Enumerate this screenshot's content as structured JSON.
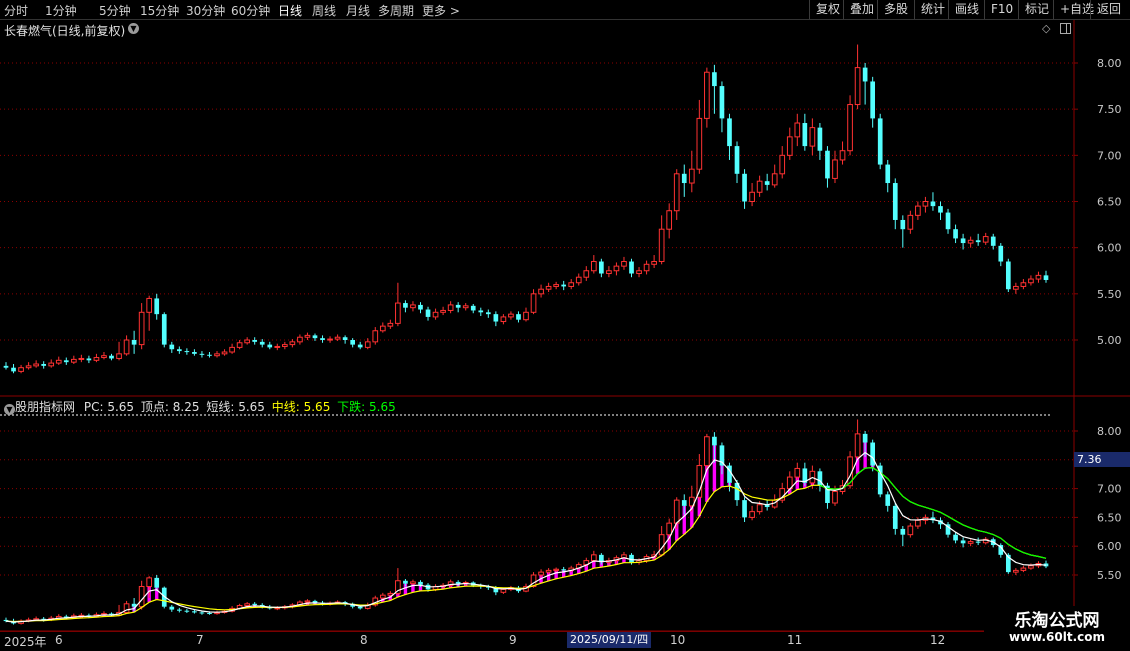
{
  "toolbar": {
    "periods": [
      "分时",
      "1分钟",
      "5分钟",
      "15分钟",
      "30分钟",
      "60分钟",
      "日线",
      "周线",
      "月线",
      "多周期",
      "更多 >"
    ],
    "active_period": "日线",
    "buttons": [
      "复权",
      "叠加",
      "多股",
      "统计",
      "画线",
      "F10",
      "标记",
      "+自选",
      "返回"
    ]
  },
  "stock_title": "长春燃气(日线,前复权)",
  "indicator": {
    "name": "股朋指标网",
    "pc_label": "PC:",
    "pc_value": "5.65",
    "top_label": "顶点:",
    "top_value": "8.25",
    "short_label": "短线:",
    "short_value": "5.65",
    "mid_label": "中线:",
    "mid_value": "5.65",
    "down_label": "下跌:",
    "down_value": "5.65"
  },
  "cursor_price": "7.36",
  "cursor_date": "2025/09/11/四",
  "date_labels": [
    "2025年",
    "6",
    "7",
    "8",
    "9",
    "10",
    "11",
    "12"
  ],
  "watermark": {
    "title": "乐淘公式网",
    "url": "www.60lt.com"
  },
  "colors": {
    "up": "#ff3232",
    "down": "#54ffff",
    "grid": "#8b0000",
    "white_line": "#ffffff",
    "yellow_line": "#ffff00",
    "green_line": "#00ff00",
    "magenta": "#ff00ff"
  },
  "chart_data": {
    "type": "candlestick",
    "y_ticks_main": [
      "8.00",
      "7.50",
      "7.00",
      "6.50",
      "6.00",
      "5.50",
      "5.00"
    ],
    "y_ticks_ind": [
      "8.00",
      "7.50",
      "7.00",
      "6.50",
      "6.00",
      "5.50"
    ],
    "ylim_main": [
      4.6,
      8.3
    ],
    "ylim_ind": [
      5.3,
      8.4
    ],
    "candles": [
      [
        4.72,
        4.7,
        4.76,
        4.68
      ],
      [
        4.7,
        4.66,
        4.74,
        4.64
      ],
      [
        4.66,
        4.7,
        4.73,
        4.64
      ],
      [
        4.7,
        4.72,
        4.76,
        4.68
      ],
      [
        4.72,
        4.74,
        4.78,
        4.7
      ],
      [
        4.74,
        4.72,
        4.77,
        4.69
      ],
      [
        4.72,
        4.75,
        4.79,
        4.7
      ],
      [
        4.75,
        4.78,
        4.82,
        4.73
      ],
      [
        4.78,
        4.76,
        4.81,
        4.73
      ],
      [
        4.76,
        4.79,
        4.83,
        4.74
      ],
      [
        4.79,
        4.8,
        4.84,
        4.76
      ],
      [
        4.8,
        4.78,
        4.83,
        4.75
      ],
      [
        4.78,
        4.81,
        4.85,
        4.76
      ],
      [
        4.81,
        4.83,
        4.87,
        4.79
      ],
      [
        4.83,
        4.8,
        4.85,
        4.78
      ],
      [
        4.8,
        4.85,
        4.98,
        4.78
      ],
      [
        4.85,
        5.0,
        5.05,
        4.83
      ],
      [
        5.0,
        4.95,
        5.1,
        4.85
      ],
      [
        4.95,
        5.3,
        5.4,
        4.9
      ],
      [
        5.3,
        5.45,
        5.48,
        5.1
      ],
      [
        5.45,
        5.28,
        5.5,
        5.22
      ],
      [
        5.28,
        4.95,
        5.3,
        4.92
      ],
      [
        4.95,
        4.9,
        4.98,
        4.86
      ],
      [
        4.9,
        4.88,
        4.93,
        4.85
      ],
      [
        4.88,
        4.87,
        4.91,
        4.84
      ],
      [
        4.87,
        4.85,
        4.9,
        4.83
      ],
      [
        4.85,
        4.84,
        4.88,
        4.81
      ],
      [
        4.84,
        4.83,
        4.87,
        4.81
      ],
      [
        4.83,
        4.85,
        4.88,
        4.81
      ],
      [
        4.85,
        4.87,
        4.9,
        4.83
      ],
      [
        4.87,
        4.92,
        4.96,
        4.85
      ],
      [
        4.92,
        4.97,
        5.0,
        4.9
      ],
      [
        4.97,
        5.0,
        5.03,
        4.95
      ],
      [
        5.0,
        4.98,
        5.03,
        4.95
      ],
      [
        4.98,
        4.95,
        5.01,
        4.92
      ],
      [
        4.95,
        4.92,
        4.98,
        4.9
      ],
      [
        4.92,
        4.93,
        4.96,
        4.89
      ],
      [
        4.93,
        4.95,
        4.98,
        4.9
      ],
      [
        4.95,
        4.98,
        5.01,
        4.92
      ],
      [
        4.98,
        5.03,
        5.06,
        4.95
      ],
      [
        5.03,
        5.05,
        5.08,
        5.0
      ],
      [
        5.05,
        5.02,
        5.07,
        4.99
      ],
      [
        5.02,
        5.0,
        5.05,
        4.97
      ],
      [
        5.0,
        5.01,
        5.04,
        4.97
      ],
      [
        5.01,
        5.03,
        5.06,
        4.99
      ],
      [
        5.03,
        5.0,
        5.05,
        4.96
      ],
      [
        5.0,
        4.95,
        5.02,
        4.92
      ],
      [
        4.95,
        4.92,
        4.98,
        4.9
      ],
      [
        4.92,
        4.98,
        5.02,
        4.9
      ],
      [
        4.98,
        5.1,
        5.14,
        4.95
      ],
      [
        5.1,
        5.15,
        5.19,
        5.08
      ],
      [
        5.15,
        5.18,
        5.22,
        5.12
      ],
      [
        5.18,
        5.4,
        5.62,
        5.15
      ],
      [
        5.4,
        5.35,
        5.43,
        5.3
      ],
      [
        5.35,
        5.38,
        5.42,
        5.31
      ],
      [
        5.38,
        5.33,
        5.41,
        5.29
      ],
      [
        5.33,
        5.25,
        5.36,
        5.21
      ],
      [
        5.25,
        5.3,
        5.34,
        5.22
      ],
      [
        5.3,
        5.32,
        5.36,
        5.27
      ],
      [
        5.32,
        5.38,
        5.42,
        5.29
      ],
      [
        5.38,
        5.35,
        5.41,
        5.3
      ],
      [
        5.35,
        5.37,
        5.4,
        5.32
      ],
      [
        5.37,
        5.32,
        5.39,
        5.29
      ],
      [
        5.32,
        5.3,
        5.35,
        5.26
      ],
      [
        5.3,
        5.28,
        5.33,
        5.24
      ],
      [
        5.28,
        5.2,
        5.31,
        5.15
      ],
      [
        5.2,
        5.25,
        5.28,
        5.17
      ],
      [
        5.25,
        5.28,
        5.31,
        5.22
      ],
      [
        5.28,
        5.22,
        5.31,
        5.19
      ],
      [
        5.22,
        5.3,
        5.35,
        5.2
      ],
      [
        5.3,
        5.5,
        5.55,
        5.28
      ],
      [
        5.5,
        5.55,
        5.6,
        5.46
      ],
      [
        5.55,
        5.58,
        5.62,
        5.52
      ],
      [
        5.58,
        5.6,
        5.63,
        5.55
      ],
      [
        5.6,
        5.58,
        5.64,
        5.54
      ],
      [
        5.58,
        5.62,
        5.66,
        5.55
      ],
      [
        5.62,
        5.68,
        5.72,
        5.59
      ],
      [
        5.68,
        5.75,
        5.8,
        5.64
      ],
      [
        5.75,
        5.85,
        5.92,
        5.72
      ],
      [
        5.85,
        5.72,
        5.88,
        5.68
      ],
      [
        5.72,
        5.75,
        5.8,
        5.68
      ],
      [
        5.75,
        5.8,
        5.84,
        5.7
      ],
      [
        5.8,
        5.85,
        5.9,
        5.76
      ],
      [
        5.85,
        5.72,
        5.88,
        5.68
      ],
      [
        5.72,
        5.75,
        5.79,
        5.68
      ],
      [
        5.75,
        5.82,
        5.86,
        5.71
      ],
      [
        5.82,
        5.85,
        5.92,
        5.78
      ],
      [
        5.85,
        6.2,
        6.35,
        5.82
      ],
      [
        6.2,
        6.4,
        6.48,
        6.1
      ],
      [
        6.4,
        6.8,
        6.85,
        6.3
      ],
      [
        6.8,
        6.7,
        6.9,
        6.55
      ],
      [
        6.7,
        6.85,
        7.05,
        6.6
      ],
      [
        6.85,
        7.4,
        7.6,
        6.8
      ],
      [
        7.4,
        7.9,
        7.95,
        7.3
      ],
      [
        7.9,
        7.75,
        7.98,
        7.45
      ],
      [
        7.75,
        7.4,
        7.8,
        7.25
      ],
      [
        7.4,
        7.1,
        7.45,
        6.95
      ],
      [
        7.1,
        6.8,
        7.15,
        6.7
      ],
      [
        6.8,
        6.5,
        6.85,
        6.42
      ],
      [
        6.5,
        6.6,
        6.7,
        6.45
      ],
      [
        6.6,
        6.72,
        6.78,
        6.55
      ],
      [
        6.72,
        6.68,
        6.8,
        6.62
      ],
      [
        6.68,
        6.8,
        6.9,
        6.65
      ],
      [
        6.8,
        7.0,
        7.1,
        6.75
      ],
      [
        7.0,
        7.2,
        7.3,
        6.95
      ],
      [
        7.2,
        7.35,
        7.45,
        7.1
      ],
      [
        7.35,
        7.1,
        7.45,
        7.05
      ],
      [
        7.1,
        7.3,
        7.4,
        7.0
      ],
      [
        7.3,
        7.05,
        7.35,
        6.95
      ],
      [
        7.05,
        6.75,
        7.1,
        6.65
      ],
      [
        6.75,
        6.95,
        7.05,
        6.7
      ],
      [
        6.95,
        7.05,
        7.15,
        6.9
      ],
      [
        7.05,
        7.55,
        7.65,
        7.0
      ],
      [
        7.55,
        7.95,
        8.2,
        7.5
      ],
      [
        7.95,
        7.8,
        8.0,
        7.55
      ],
      [
        7.8,
        7.4,
        7.85,
        7.3
      ],
      [
        7.4,
        6.9,
        7.45,
        6.85
      ],
      [
        6.9,
        6.7,
        6.95,
        6.6
      ],
      [
        6.7,
        6.3,
        6.75,
        6.2
      ],
      [
        6.3,
        6.2,
        6.35,
        6.0
      ],
      [
        6.2,
        6.35,
        6.4,
        6.15
      ],
      [
        6.35,
        6.45,
        6.5,
        6.3
      ],
      [
        6.45,
        6.5,
        6.55,
        6.38
      ],
      [
        6.5,
        6.45,
        6.6,
        6.4
      ],
      [
        6.45,
        6.38,
        6.5,
        6.3
      ],
      [
        6.38,
        6.2,
        6.42,
        6.15
      ],
      [
        6.2,
        6.1,
        6.25,
        6.05
      ],
      [
        6.1,
        6.05,
        6.15,
        5.98
      ],
      [
        6.05,
        6.08,
        6.12,
        6.0
      ],
      [
        6.08,
        6.06,
        6.15,
        6.02
      ],
      [
        6.06,
        6.12,
        6.16,
        6.03
      ],
      [
        6.12,
        6.02,
        6.15,
        5.98
      ],
      [
        6.02,
        5.85,
        6.05,
        5.8
      ],
      [
        5.85,
        5.55,
        5.88,
        5.52
      ],
      [
        5.55,
        5.58,
        5.62,
        5.5
      ],
      [
        5.58,
        5.62,
        5.66,
        5.55
      ],
      [
        5.62,
        5.66,
        5.7,
        5.59
      ],
      [
        5.66,
        5.7,
        5.74,
        5.62
      ],
      [
        5.7,
        5.65,
        5.75,
        5.62
      ]
    ]
  }
}
